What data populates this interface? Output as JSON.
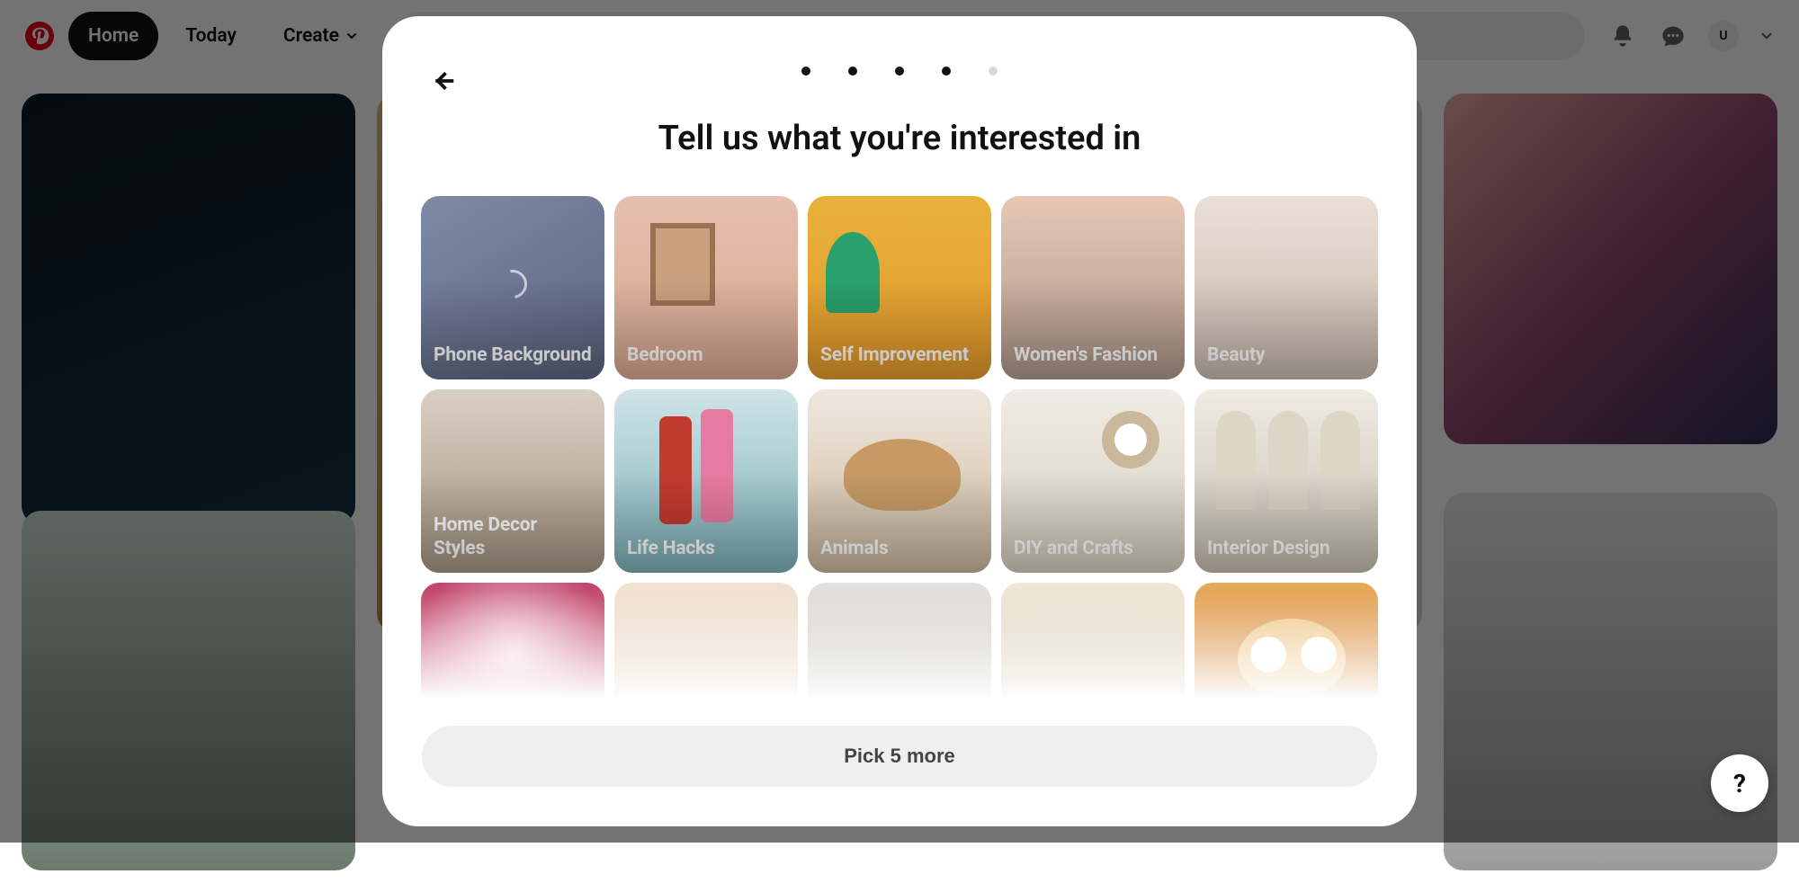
{
  "header": {
    "home": "Home",
    "today": "Today",
    "create": "Create",
    "avatar_initial": "U"
  },
  "modal": {
    "progress_total": 5,
    "progress_done": 4,
    "title": "Tell us what you're interested in",
    "tiles": [
      "Phone Background",
      "Bedroom",
      "Self Improvement",
      "Women's Fashion",
      "Beauty",
      "Home Decor Styles",
      "Life Hacks",
      "Animals",
      "DIY and Crafts",
      "Interior Design",
      "",
      "",
      "",
      "",
      ""
    ],
    "cta": "Pick 5 more"
  },
  "help_label": "?"
}
